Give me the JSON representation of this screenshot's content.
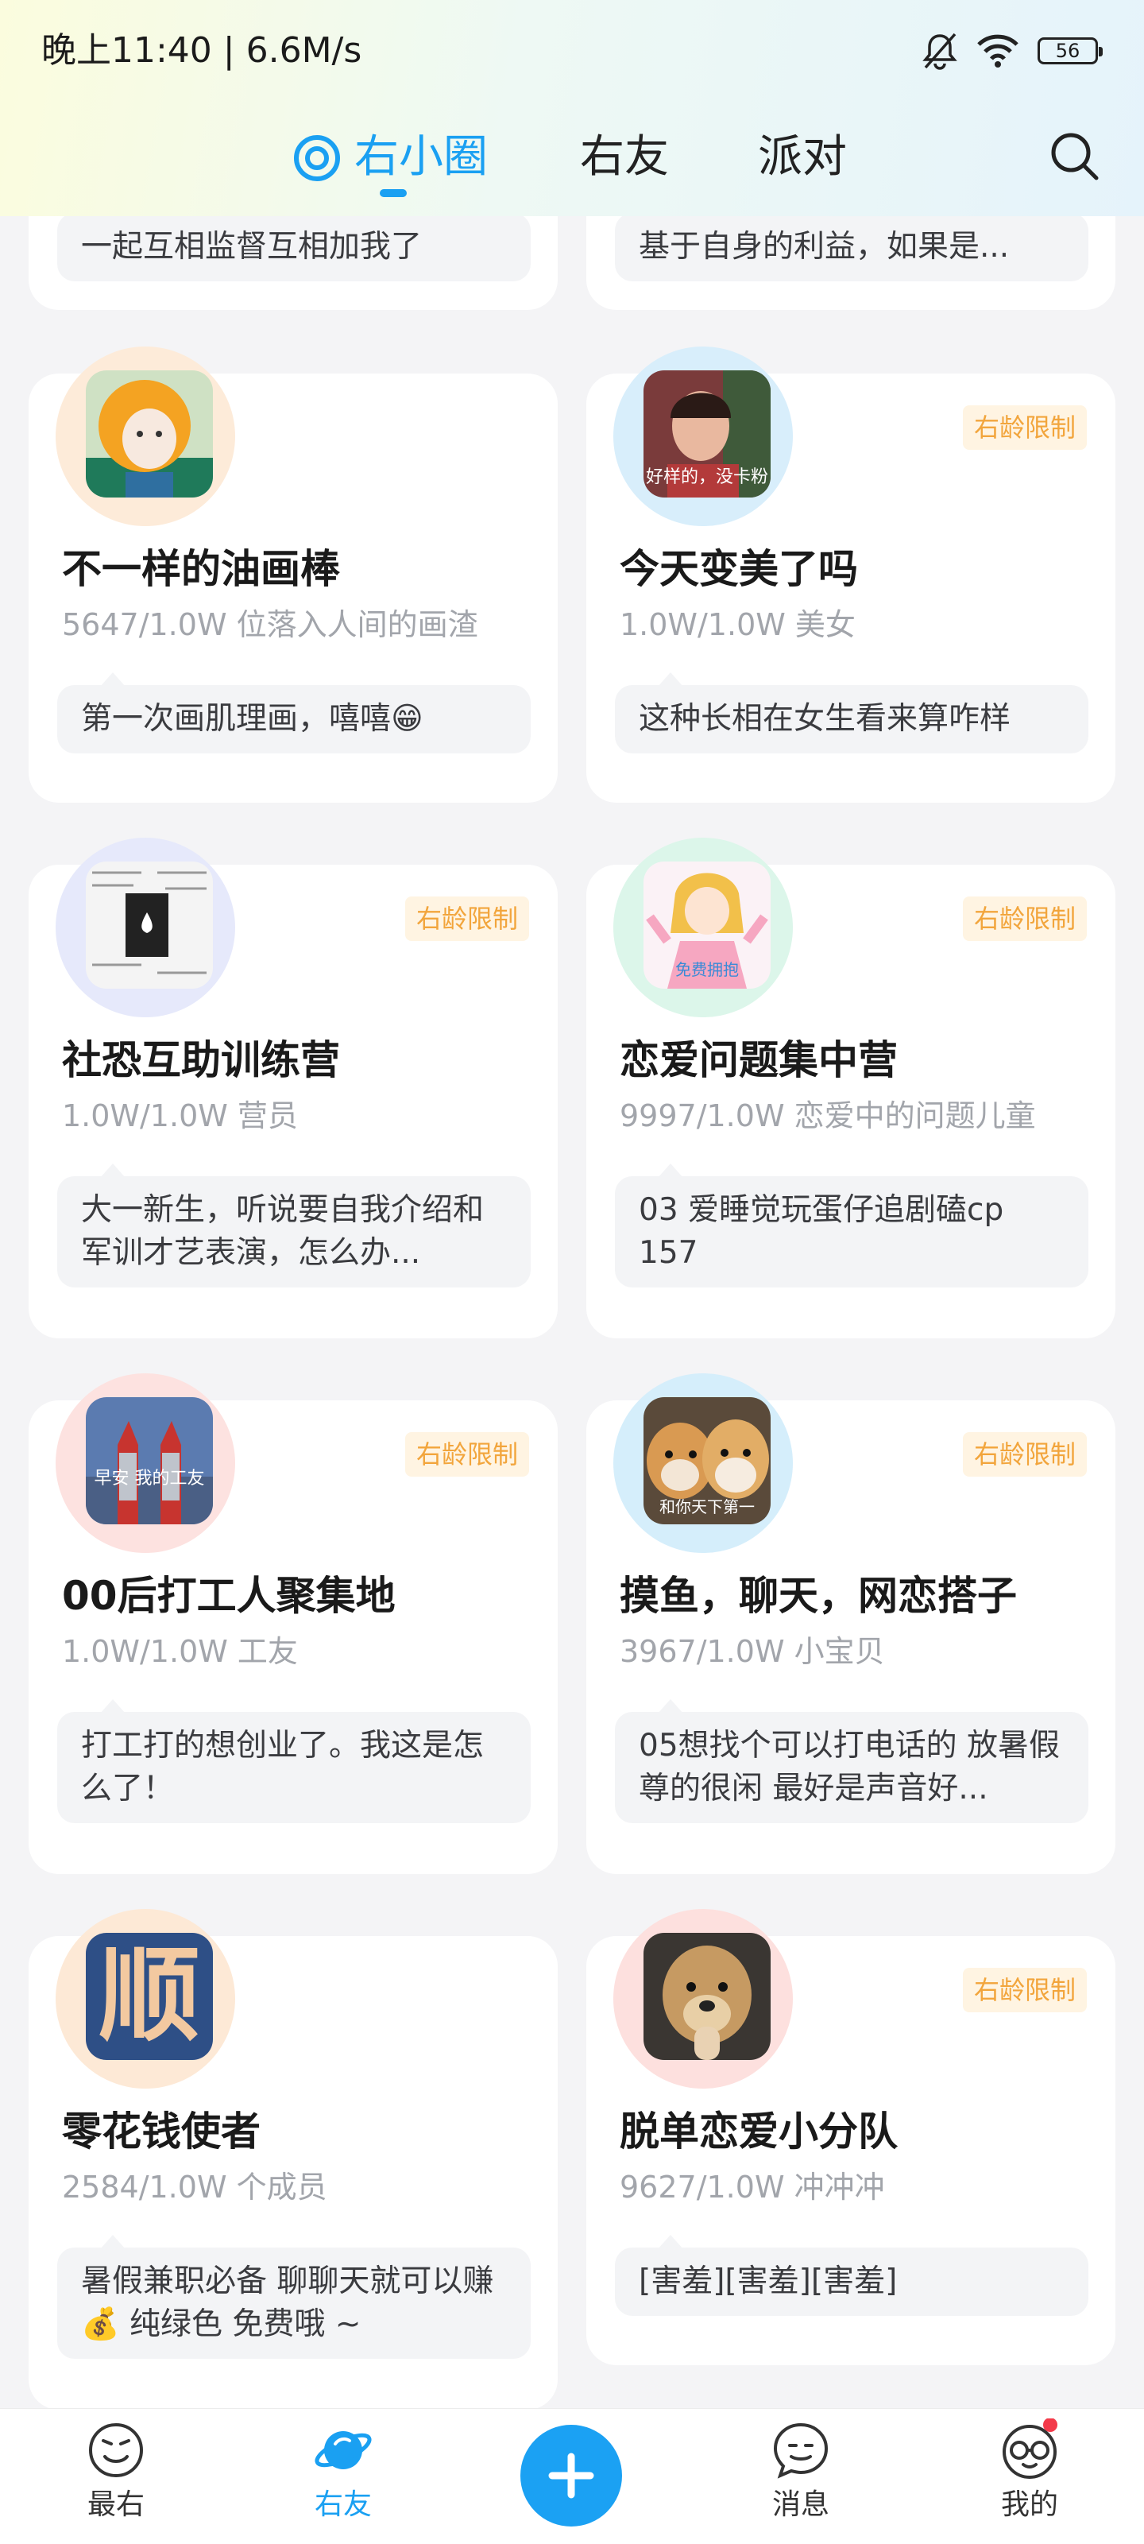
{
  "status_bar": {
    "time_speed": "晚上11:40 | 6.6M/s",
    "battery": "56"
  },
  "top_nav": {
    "tabs": [
      "右小圈",
      "右友",
      "派对"
    ]
  },
  "partial_cards": [
    {
      "snippet": "一起互相监督互相加我了"
    },
    {
      "snippet": "基于自身的利益，如果是..."
    }
  ],
  "cards": [
    {
      "title": "不一样的油画棒",
      "meta": "5647/1.0W 位落入人间的画渣",
      "snippet": "第一次画肌理画，嘻嘻😁",
      "badge": ""
    },
    {
      "title": "今天变美了吗",
      "meta": "1.0W/1.0W 美女",
      "snippet": "这种长相在女生看来算咋样",
      "badge": "右龄限制"
    },
    {
      "title": "社恐互助训练营",
      "meta": "1.0W/1.0W 营员",
      "snippet": "大一新生，听说要自我介绍和军训才艺表演，怎么办...",
      "badge": "右龄限制"
    },
    {
      "title": "恋爱问题集中营",
      "meta": "9997/1.0W 恋爱中的问题儿童",
      "snippet": "03 爱睡觉玩蛋仔追剧磕cp 157",
      "badge": "右龄限制"
    },
    {
      "title": "00后打工人聚集地",
      "meta": "1.0W/1.0W 工友",
      "snippet": "打工打的想创业了。我这是怎么了！",
      "badge": "右龄限制"
    },
    {
      "title": "摸鱼，聊天，网恋搭子",
      "meta": "3967/1.0W 小宝贝",
      "snippet": "05想找个可以打电话的 放暑假尊的很闲 最好是声音好...",
      "badge": "右龄限制"
    },
    {
      "title": "零花钱使者",
      "meta": "2584/1.0W 个成员",
      "snippet": "暑假兼职必备  聊聊天就可以赚💰 纯绿色  免费哦 ~",
      "badge": ""
    },
    {
      "title": "脱单恋爱小分队",
      "meta": "9627/1.0W 冲冲冲",
      "snippet": "[害羞][害羞][害羞]",
      "badge": "右龄限制"
    }
  ],
  "avatar_texts": {
    "a2": "好样的，没卡粉",
    "a4": "免费拥抱",
    "a5": "早安 我的工友",
    "a6": "和你天下第一",
    "a7": "顺"
  },
  "bottom_tabs": [
    "最右",
    "右友",
    "消息",
    "我的"
  ],
  "colors": {
    "accent": "#1aa0f2",
    "badge_text": "#f2a53c",
    "badge_bg": "#fff4e2",
    "notification_dot": "#f33a4a"
  }
}
